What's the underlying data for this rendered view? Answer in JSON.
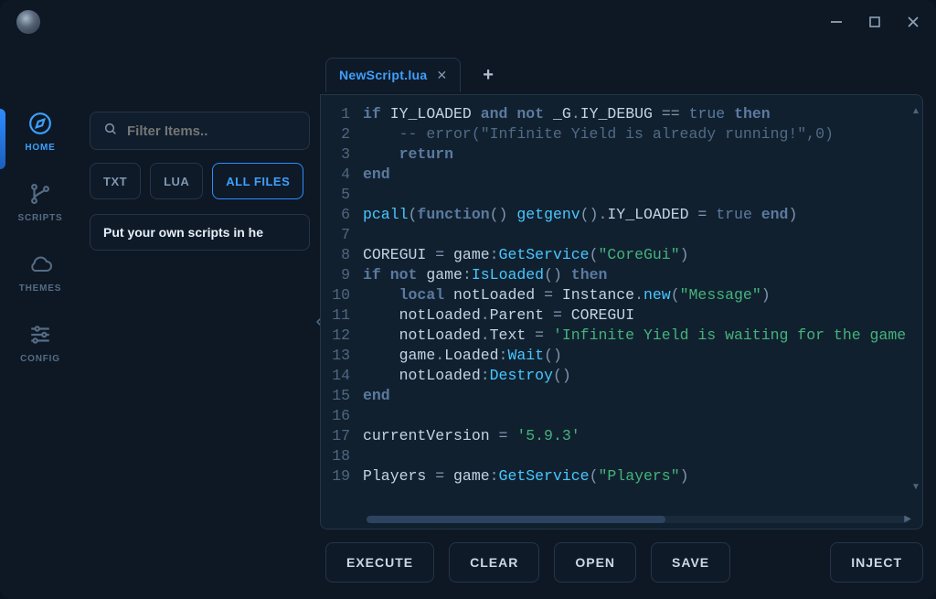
{
  "sidebar": {
    "items": [
      {
        "label": "HOME",
        "icon": "compass-icon",
        "active": true
      },
      {
        "label": "SCRIPTS",
        "icon": "branch-icon",
        "active": false
      },
      {
        "label": "THEMES",
        "icon": "cloud-icon",
        "active": false
      },
      {
        "label": "CONFIG",
        "icon": "sliders-icon",
        "active": false
      }
    ]
  },
  "filter": {
    "placeholder": "Filter Items..",
    "chips": [
      "TXT",
      "LUA",
      "ALL FILES"
    ],
    "active_chip": "ALL FILES"
  },
  "scripts": {
    "items": [
      "Put your own scripts in he"
    ]
  },
  "tabs": {
    "items": [
      {
        "label": "NewScript.lua"
      }
    ],
    "add": "+"
  },
  "code": {
    "lines": [
      {
        "n": 1,
        "seg": [
          [
            "kw",
            "if"
          ],
          [
            "sp",
            " "
          ],
          [
            "id",
            "IY_LOADED"
          ],
          [
            "sp",
            " "
          ],
          [
            "kw",
            "and"
          ],
          [
            "sp",
            " "
          ],
          [
            "kw",
            "not"
          ],
          [
            "sp",
            " "
          ],
          [
            "id",
            "_G"
          ],
          [
            "op",
            "."
          ],
          [
            "id",
            "IY_DEBUG"
          ],
          [
            "sp",
            " "
          ],
          [
            "op",
            "=="
          ],
          [
            "sp",
            " "
          ],
          [
            "bool",
            "true"
          ],
          [
            "sp",
            " "
          ],
          [
            "kw",
            "then"
          ]
        ]
      },
      {
        "n": 2,
        "seg": [
          [
            "sp",
            "    "
          ],
          [
            "cmt",
            "-- error(\"Infinite Yield is already running!\",0)"
          ]
        ]
      },
      {
        "n": 3,
        "seg": [
          [
            "sp",
            "    "
          ],
          [
            "kw",
            "return"
          ]
        ]
      },
      {
        "n": 4,
        "seg": [
          [
            "kw",
            "end"
          ]
        ]
      },
      {
        "n": 5,
        "seg": []
      },
      {
        "n": 6,
        "seg": [
          [
            "fn",
            "pcall"
          ],
          [
            "op",
            "("
          ],
          [
            "kw",
            "function"
          ],
          [
            "op",
            "()"
          ],
          [
            "sp",
            " "
          ],
          [
            "fn",
            "getgenv"
          ],
          [
            "op",
            "()."
          ],
          [
            "id",
            "IY_LOADED"
          ],
          [
            "sp",
            " "
          ],
          [
            "op",
            "="
          ],
          [
            "sp",
            " "
          ],
          [
            "bool",
            "true"
          ],
          [
            "sp",
            " "
          ],
          [
            "kw",
            "end"
          ],
          [
            "op",
            ")"
          ]
        ]
      },
      {
        "n": 7,
        "seg": []
      },
      {
        "n": 8,
        "seg": [
          [
            "id",
            "COREGUI"
          ],
          [
            "sp",
            " "
          ],
          [
            "op",
            "="
          ],
          [
            "sp",
            " "
          ],
          [
            "id",
            "game"
          ],
          [
            "op",
            ":"
          ],
          [
            "fn",
            "GetService"
          ],
          [
            "op",
            "("
          ],
          [
            "str",
            "\"CoreGui\""
          ],
          [
            "op",
            ")"
          ]
        ]
      },
      {
        "n": 9,
        "seg": [
          [
            "kw",
            "if"
          ],
          [
            "sp",
            " "
          ],
          [
            "kw",
            "not"
          ],
          [
            "sp",
            " "
          ],
          [
            "id",
            "game"
          ],
          [
            "op",
            ":"
          ],
          [
            "fn",
            "IsLoaded"
          ],
          [
            "op",
            "()"
          ],
          [
            "sp",
            " "
          ],
          [
            "kw",
            "then"
          ]
        ]
      },
      {
        "n": 10,
        "seg": [
          [
            "sp",
            "    "
          ],
          [
            "kw",
            "local"
          ],
          [
            "sp",
            " "
          ],
          [
            "id",
            "notLoaded"
          ],
          [
            "sp",
            " "
          ],
          [
            "op",
            "="
          ],
          [
            "sp",
            " "
          ],
          [
            "id",
            "Instance"
          ],
          [
            "op",
            "."
          ],
          [
            "fn",
            "new"
          ],
          [
            "op",
            "("
          ],
          [
            "str",
            "\"Message\""
          ],
          [
            "op",
            ")"
          ]
        ]
      },
      {
        "n": 11,
        "seg": [
          [
            "sp",
            "    "
          ],
          [
            "id",
            "notLoaded"
          ],
          [
            "op",
            "."
          ],
          [
            "id",
            "Parent"
          ],
          [
            "sp",
            " "
          ],
          [
            "op",
            "="
          ],
          [
            "sp",
            " "
          ],
          [
            "id",
            "COREGUI"
          ]
        ]
      },
      {
        "n": 12,
        "seg": [
          [
            "sp",
            "    "
          ],
          [
            "id",
            "notLoaded"
          ],
          [
            "op",
            "."
          ],
          [
            "id",
            "Text"
          ],
          [
            "sp",
            " "
          ],
          [
            "op",
            "="
          ],
          [
            "sp",
            " "
          ],
          [
            "str",
            "'Infinite Yield is waiting for the game"
          ]
        ]
      },
      {
        "n": 13,
        "seg": [
          [
            "sp",
            "    "
          ],
          [
            "id",
            "game"
          ],
          [
            "op",
            "."
          ],
          [
            "id",
            "Loaded"
          ],
          [
            "op",
            ":"
          ],
          [
            "fn",
            "Wait"
          ],
          [
            "op",
            "()"
          ]
        ]
      },
      {
        "n": 14,
        "seg": [
          [
            "sp",
            "    "
          ],
          [
            "id",
            "notLoaded"
          ],
          [
            "op",
            ":"
          ],
          [
            "fn",
            "Destroy"
          ],
          [
            "op",
            "()"
          ]
        ]
      },
      {
        "n": 15,
        "seg": [
          [
            "kw",
            "end"
          ]
        ]
      },
      {
        "n": 16,
        "seg": []
      },
      {
        "n": 17,
        "seg": [
          [
            "id",
            "currentVersion"
          ],
          [
            "sp",
            " "
          ],
          [
            "op",
            "="
          ],
          [
            "sp",
            " "
          ],
          [
            "str",
            "'5.9.3'"
          ]
        ]
      },
      {
        "n": 18,
        "seg": []
      },
      {
        "n": 19,
        "seg": [
          [
            "id",
            "Players"
          ],
          [
            "sp",
            " "
          ],
          [
            "op",
            "="
          ],
          [
            "sp",
            " "
          ],
          [
            "id",
            "game"
          ],
          [
            "op",
            ":"
          ],
          [
            "fn",
            "GetService"
          ],
          [
            "op",
            "("
          ],
          [
            "str",
            "\"Players\""
          ],
          [
            "op",
            ")"
          ]
        ]
      }
    ]
  },
  "actions": {
    "execute": "EXECUTE",
    "clear": "CLEAR",
    "open": "OPEN",
    "save": "SAVE",
    "inject": "INJECT"
  },
  "window": {
    "minimize": "—",
    "maximize": "□",
    "close": "✕"
  }
}
